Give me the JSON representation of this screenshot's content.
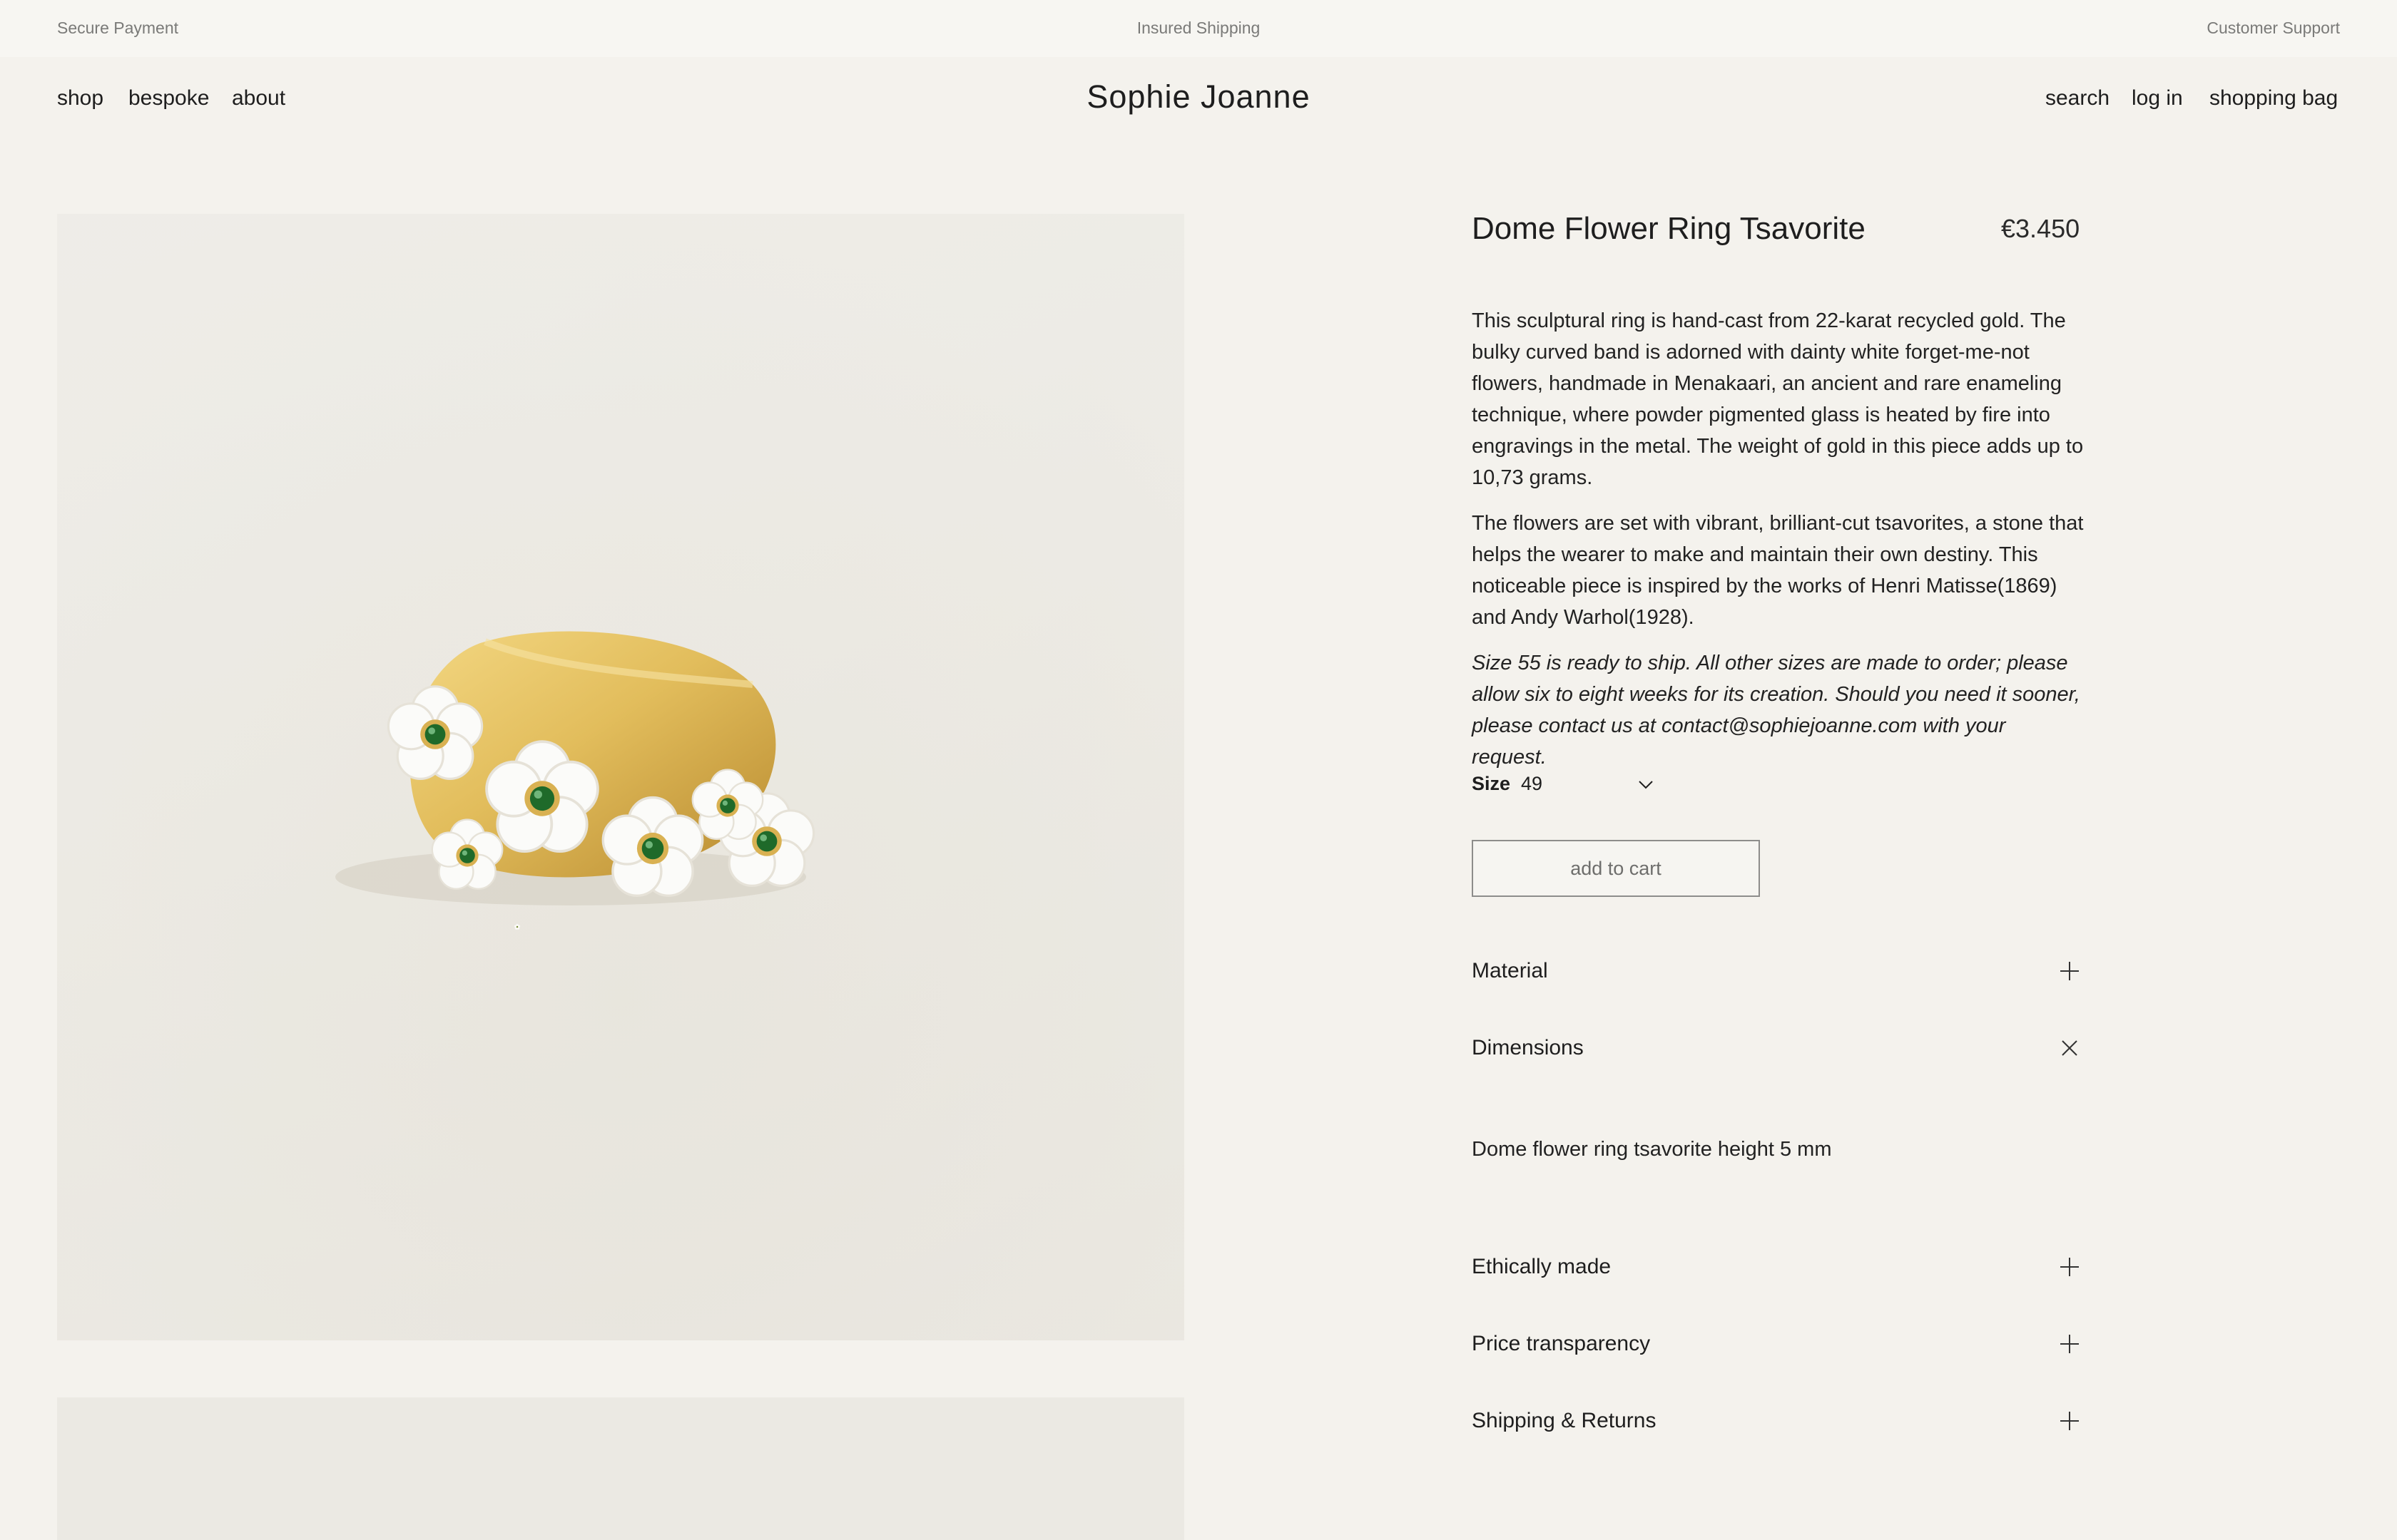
{
  "topbar": {
    "left": "Secure Payment",
    "center": "Insured Shipping",
    "right": "Customer Support"
  },
  "nav": {
    "left": [
      "shop",
      "bespoke",
      "about"
    ],
    "brand": "Sophie Joanne",
    "right": [
      "search",
      "log in",
      "shopping bag"
    ]
  },
  "product": {
    "title": "Dome Flower Ring Tsavorite",
    "price": "€3.450",
    "description": [
      "This sculptural ring is hand-cast from 22-karat recycled gold. The bulky curved band is adorned with dainty white forget-me-not flowers, handmade in Menakaari, an ancient and rare enameling technique, where powder pigmented glass is heated by fire into engravings in the metal.  The weight of gold in this piece adds up to 10,73 grams.",
      "The flowers are set with vibrant, brilliant-cut tsavorites, a stone that helps the wearer to make and maintain their own destiny. This noticeable piece is inspired by the works of Henri Matisse(1869) and Andy Warhol(1928)."
    ],
    "note": "Size 55 is ready to ship. All other sizes are made to order; please allow six to eight weeks for its creation. Should you need it sooner, please contact us at contact@sophiejoanne.com with your request.",
    "size_label": "Size",
    "size_value": "49",
    "add_to_cart": "add to cart"
  },
  "accordion": {
    "material": {
      "label": "Material",
      "icon": "plus-icon"
    },
    "dimensions": {
      "label": "Dimensions",
      "icon": "close-icon",
      "content": "Dome flower ring tsavorite height 5 mm"
    },
    "ethically": {
      "label": "Ethically made",
      "icon": "plus-icon"
    },
    "price_transparency": {
      "label": "Price transparency",
      "icon": "plus-icon"
    },
    "shipping": {
      "label": "Shipping & Returns",
      "icon": "plus-icon"
    }
  },
  "images": {
    "main": "gold-enamel-flower-ring-photo",
    "secondary": "product-photo-secondary"
  },
  "colors": {
    "background": "#f4f2ed",
    "topbar": "#f7f6f2",
    "text": "#1e1e1e",
    "gold": "#e0bb5a",
    "tsavorite": "#1f6a2a"
  }
}
